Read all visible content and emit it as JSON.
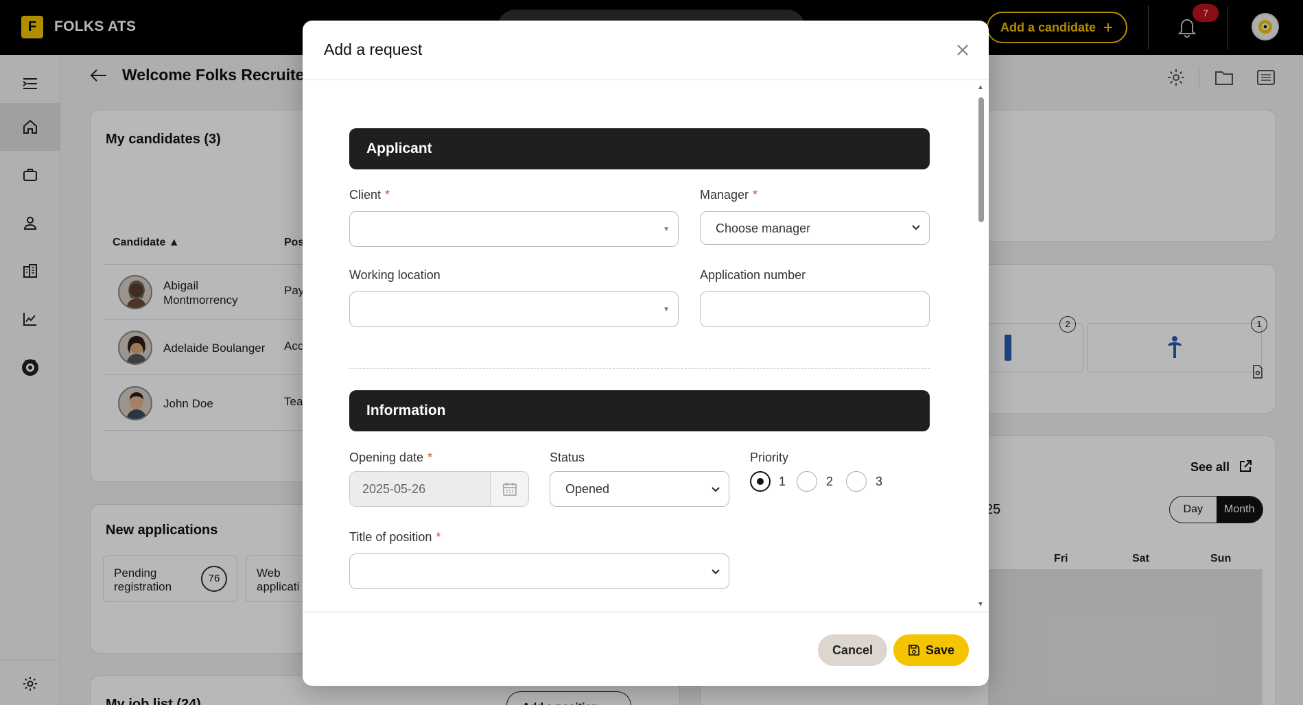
{
  "app": {
    "logo_letter": "F",
    "name": "FOLKS ATS",
    "add_candidate_label": "Add a candidate",
    "notifications_count": "7"
  },
  "page": {
    "welcome": "Welcome Folks Recruiter",
    "my_candidates": {
      "title": "My candidates (3)",
      "col_candidate": "Candidate ▲",
      "col_position": "Pos",
      "rows": [
        {
          "name": "Abigail Montmorrency",
          "pos": "Pay"
        },
        {
          "name": "Adelaide Boulanger",
          "pos": "Acc"
        },
        {
          "name": "John Doe",
          "pos": "Tea"
        }
      ]
    },
    "new_applications": {
      "title": "New applications",
      "pending_label": "Pending registration",
      "pending_count": "76",
      "web_label": "Web applicati"
    },
    "job_list": {
      "title": "My job list (24)",
      "add_position": "Add a position"
    },
    "right_panel": {
      "count_a": "2",
      "count_b": "1",
      "see_all": "See all",
      "month_fragment": "25",
      "view_day": "Day",
      "view_month": "Month",
      "days": [
        "Fri",
        "Sat",
        "Sun"
      ]
    }
  },
  "modal": {
    "title": "Add a request",
    "section_applicant": "Applicant",
    "client_label": "Client",
    "manager_label": "Manager",
    "manager_value": "Choose manager",
    "working_location_label": "Working location",
    "application_number_label": "Application number",
    "section_information": "Information",
    "opening_date_label": "Opening date",
    "opening_date_value": "2025-05-26",
    "status_label": "Status",
    "status_value": "Opened",
    "priority_label": "Priority",
    "priority_options": [
      "1",
      "2",
      "3"
    ],
    "title_of_position_label": "Title of position",
    "required_mark": "*",
    "cancel_label": "Cancel",
    "save_label": "Save"
  }
}
